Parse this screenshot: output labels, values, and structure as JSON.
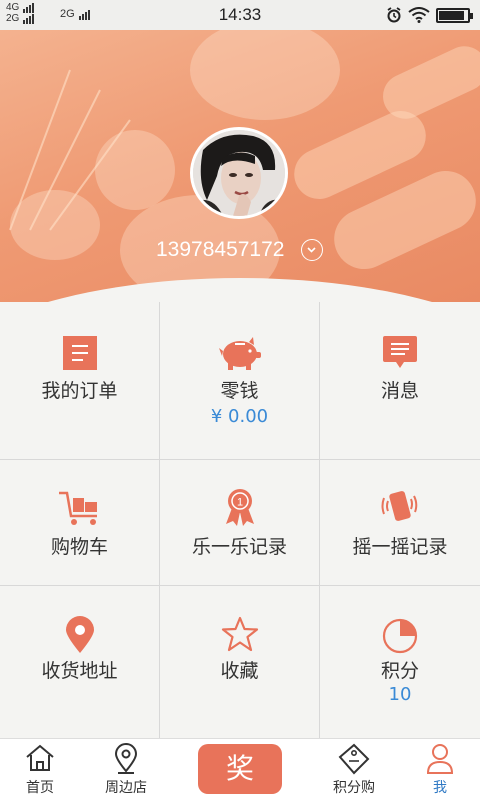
{
  "status_bar": {
    "network_1": "4G",
    "network_2": "2G",
    "network_3": "2G",
    "time": "14:33",
    "battery_level": 0.9
  },
  "profile": {
    "phone": "13978457172"
  },
  "grid": {
    "orders": {
      "label": "我的订单"
    },
    "change": {
      "label": "零钱",
      "value": "¥ 0.00"
    },
    "messages": {
      "label": "消息"
    },
    "cart": {
      "label": "购物车"
    },
    "lottery": {
      "label": "乐一乐记录"
    },
    "shake": {
      "label": "摇一摇记录"
    },
    "address": {
      "label": "收货地址"
    },
    "favorites": {
      "label": "收藏"
    },
    "points": {
      "label": "积分",
      "value": "10"
    }
  },
  "tabbar": {
    "home": "首页",
    "nearby": "周边店",
    "prize": "奖",
    "points_shop": "积分购",
    "me": "我"
  },
  "colors": {
    "accent": "#e8735a",
    "link_blue": "#3a8ad6",
    "active_tab": "#2f79c4"
  }
}
